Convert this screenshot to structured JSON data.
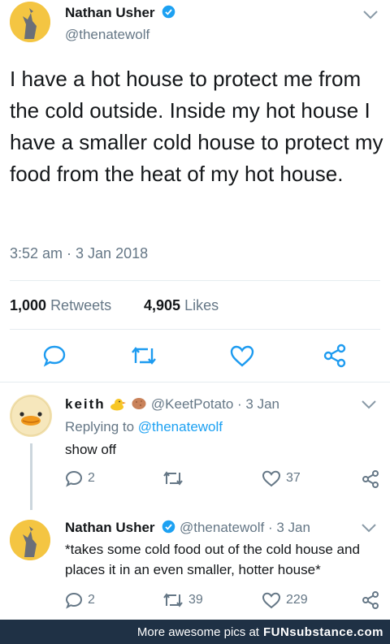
{
  "main_tweet": {
    "author_name": "Nathan Usher",
    "author_handle": "@thenatewolf",
    "text": "I have a hot house to protect me from the cold outside. Inside my hot house I have a smaller cold house to protect my food from the heat of my hot house.",
    "timestamp": "3:52 am · 3 Jan 2018",
    "retweets_count": "1,000",
    "retweets_label": "Retweets",
    "likes_count": "4,905",
    "likes_label": "Likes"
  },
  "reply1": {
    "author_name": "keith",
    "author_handle": "@KeetPotato",
    "time": "· 3 Jan",
    "replying_label": "Replying to",
    "replying_handle": "@thenatewolf",
    "text": "show off",
    "replies": "2",
    "retweets": "",
    "likes": "37"
  },
  "reply2": {
    "author_name": "Nathan Usher",
    "author_handle": "@thenatewolf",
    "time": "· 3 Jan",
    "text": "*takes some cold food out of the cold house and places it in an even smaller, hotter house*",
    "replies": "2",
    "retweets": "39",
    "likes": "229"
  },
  "footer": {
    "prefix": "More awesome pics at",
    "brand": "FUNsubstance.com"
  },
  "colors": {
    "accent": "#1da1f2",
    "footer_bg": "#1f3145"
  }
}
